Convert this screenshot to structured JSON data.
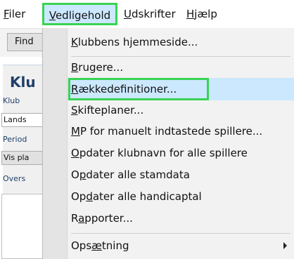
{
  "menubar": {
    "filer": {
      "accel": "F",
      "rest": "iler"
    },
    "vedligehold": {
      "accel": "V",
      "rest": "edligehold"
    },
    "udskrifter": {
      "accel": "U",
      "rest": "dskrifter"
    },
    "hjaelp": {
      "accel": "H",
      "rest": "jælp"
    }
  },
  "toolbar": {
    "find_label": "Find"
  },
  "panel": {
    "title": "Klu",
    "klub_label": "Klub",
    "lands_value": "Lands",
    "periode_label": "Period",
    "vis_button": "Vis pla",
    "overs_label": "Overs"
  },
  "dropdown": {
    "items": [
      {
        "accel": "K",
        "rest": "lubbens hjemmeside..."
      },
      {
        "accel": "B",
        "rest": "rugere..."
      },
      {
        "accel": "R",
        "rest": "ækkedefinitioner..."
      },
      {
        "accel": "S",
        "rest": "kifteplaner..."
      },
      {
        "accel": "M",
        "rest": "P for manuelt indtastede spillere..."
      },
      {
        "accel": "O",
        "rest": "pdater klubnavn for alle spillere"
      },
      {
        "pre": "O",
        "accel": "p",
        "rest": "dater alle stamdata"
      },
      {
        "pre": "Op",
        "accel": "d",
        "rest": "ater alle handicaptal"
      },
      {
        "pre": "R",
        "accel": "a",
        "rest": "pporter..."
      },
      {
        "pre": "Ops",
        "accel": "æ",
        "rest": "tning"
      }
    ]
  },
  "colors": {
    "highlight": "#cce8ff",
    "annotation_frame": "#39d353"
  }
}
